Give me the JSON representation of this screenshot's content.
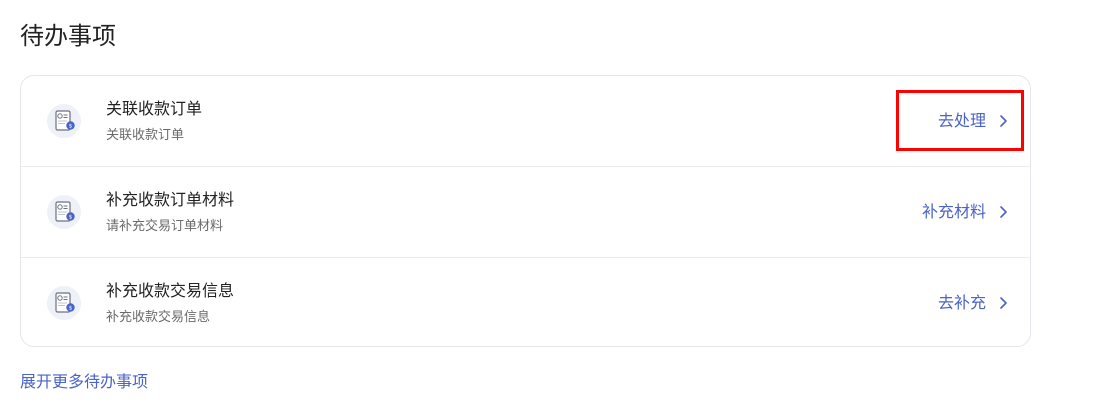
{
  "section": {
    "title": "待办事项"
  },
  "tasks": [
    {
      "title": "关联收款订单",
      "subtitle": "关联收款订单",
      "action": "去处理",
      "icon": "document-coin-icon"
    },
    {
      "title": "补充收款订单材料",
      "subtitle": "请补充交易订单材料",
      "action": "补充材料",
      "icon": "document-coin-icon"
    },
    {
      "title": "补充收款交易信息",
      "subtitle": "补充收款交易信息",
      "action": "去补充",
      "icon": "document-coin-icon"
    }
  ],
  "footer": {
    "expand_label": "展开更多待办事项"
  },
  "colors": {
    "accent": "#4a63c7",
    "highlight": "#ff0000",
    "title_text": "#222222",
    "subtitle_text": "#6a6a6a",
    "border": "#e5e6eb"
  }
}
